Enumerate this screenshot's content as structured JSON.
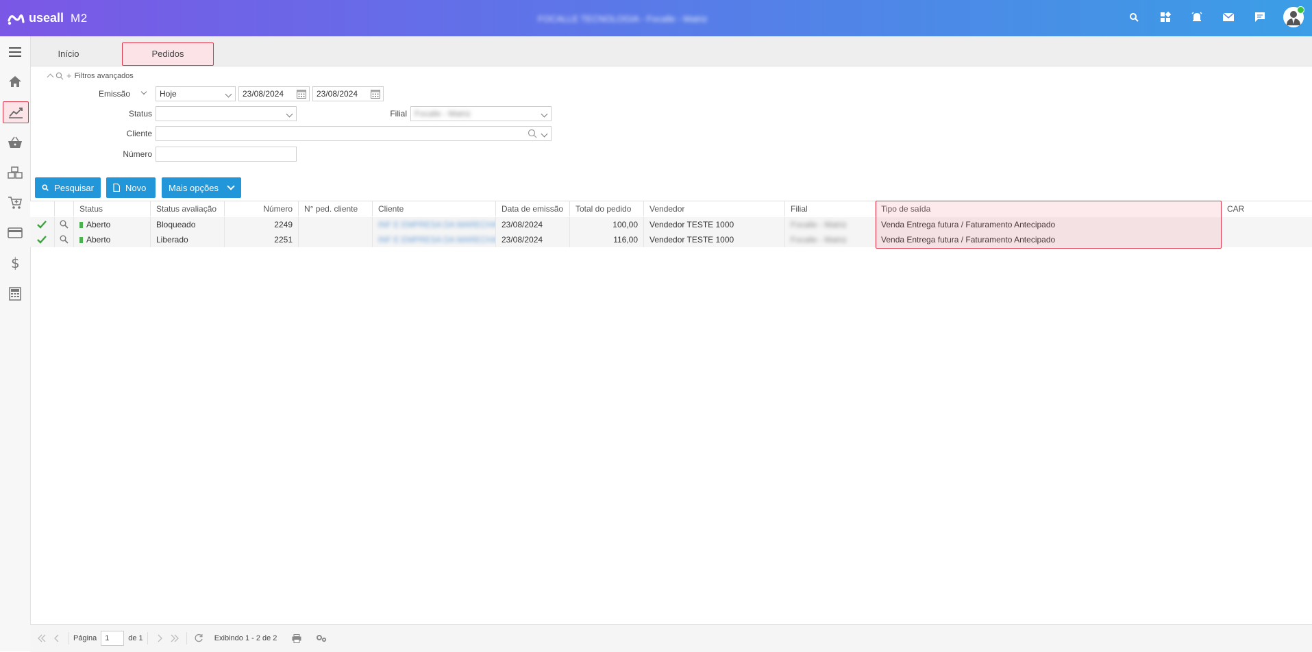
{
  "header": {
    "brand": "useall",
    "product": "M2",
    "company_name": "FOCALLE TECNOLOGIA - Focalle - Matriz"
  },
  "tabs": [
    {
      "label": "Início"
    },
    {
      "label": "Pedidos"
    }
  ],
  "filters": {
    "toggle_label": "Filtros avançados",
    "emissao_label": "Emissão",
    "emissao_period": "Hoje",
    "date_from": "23/08/2024",
    "date_to": "23/08/2024",
    "status_label": "Status",
    "status_value": "",
    "filial_label": "Filial",
    "filial_value": "Focalle - Matriz",
    "cliente_label": "Cliente",
    "cliente_value": "",
    "numero_label": "Número",
    "numero_value": ""
  },
  "actions": {
    "search_label": "Pesquisar",
    "new_label": "Novo",
    "more_label": "Mais opções"
  },
  "grid": {
    "columns": [
      "Status",
      "Status avaliação",
      "Número",
      "N° ped. cliente",
      "Cliente",
      "Data de emissão",
      "Total do pedido",
      "Vendedor",
      "Filial",
      "Tipo de saída",
      "CAR"
    ],
    "rows": [
      {
        "status": "Aberto",
        "status_avaliacao": "Bloqueado",
        "numero": "2249",
        "ped_cliente": "",
        "cliente": "INF E EMPRESA DA MARECHAL",
        "data_emissao": "23/08/2024",
        "total": "100,00",
        "vendedor": "Vendedor TESTE 1000",
        "filial": "Focalle - Matriz",
        "tipo_saida": "Venda Entrega futura / Faturamento Antecipado",
        "car": ""
      },
      {
        "status": "Aberto",
        "status_avaliacao": "Liberado",
        "numero": "2251",
        "ped_cliente": "",
        "cliente": "INF E EMPRESA DA MARECHAL",
        "data_emissao": "23/08/2024",
        "total": "116,00",
        "vendedor": "Vendedor TESTE 1000",
        "filial": "Focalle - Matriz",
        "tipo_saida": "Venda Entrega futura / Faturamento Antecipado",
        "car": ""
      }
    ]
  },
  "pager": {
    "page_label": "Página",
    "page_value": "1",
    "of_label": "de 1",
    "showing": "Exibindo 1 - 2 de 2"
  },
  "colors": {
    "header_gradient_start": "#7b57e6",
    "header_gradient_end": "#3b9ee6",
    "button_blue": "#2196d8",
    "highlight_red": "#e0344a",
    "status_green": "#4caf50"
  },
  "icons": [
    "search-icon",
    "apps-icon",
    "alarm-icon",
    "mail-icon",
    "chat-icon",
    "avatar",
    "menu-icon",
    "home-icon",
    "chart-icon",
    "basket-icon",
    "boxes-icon",
    "cart-icon",
    "card-icon",
    "dollar-icon",
    "calculator-icon"
  ]
}
